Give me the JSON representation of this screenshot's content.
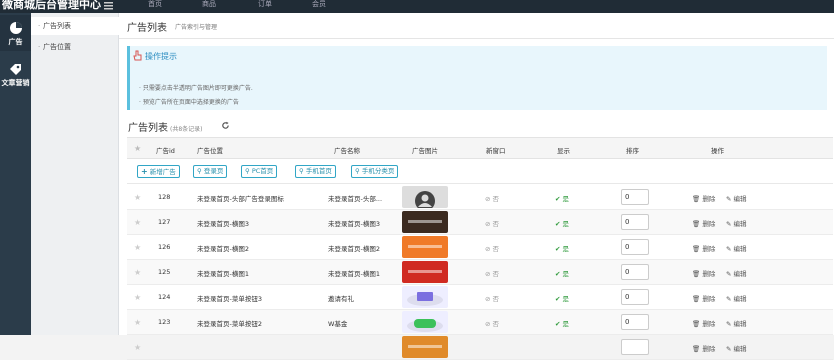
{
  "app": {
    "brand": "微商城后台管理中心",
    "top_items": [
      "首页",
      "商品",
      "订单",
      "会员"
    ]
  },
  "leftbar": [
    {
      "label": "广告",
      "icon": "pie-chart-icon",
      "active": true
    },
    {
      "label": "文章营销",
      "icon": "tag-icon",
      "active": false
    }
  ],
  "subnav": [
    {
      "label": "广告列表",
      "active": true
    },
    {
      "label": "广告位置",
      "active": false
    }
  ],
  "header": {
    "title": "广告列表",
    "subtitle": "广告索引与管理"
  },
  "tip": {
    "title": "操作提示",
    "lines": [
      "只需要点击半透明广告图片即可更换广告.",
      "预览广告所在页面中选择更换的广告"
    ]
  },
  "section": {
    "title": "广告列表",
    "count": "(共8条记录)"
  },
  "columns": [
    "广告id",
    "广告位置",
    "广告名称",
    "广告图片",
    "新窗口",
    "显示",
    "排序",
    "操作"
  ],
  "toolbar": [
    "新增广告",
    "登录页",
    "PC首页",
    "手机首页",
    "手机分类页"
  ],
  "rows": [
    {
      "id": "128",
      "position": "未登录首页-头部广告登录图标",
      "name": "未登录首页-头部...",
      "image_color": "#d6d6d6",
      "image_kind": "avatar",
      "new_window": "否",
      "show": "是",
      "sort": "0"
    },
    {
      "id": "127",
      "position": "未登录首页-横图3",
      "name": "未登录首页-横图3",
      "image_color": "#3b2a20",
      "image_kind": "banner",
      "new_window": "否",
      "show": "是",
      "sort": "0"
    },
    {
      "id": "126",
      "position": "未登录首页-横图2",
      "name": "未登录首页-横图2",
      "image_color": "#f07a28",
      "image_kind": "banner",
      "new_window": "否",
      "show": "是",
      "sort": "0"
    },
    {
      "id": "125",
      "position": "未登录首页-横图1",
      "name": "未登录首页-横图1",
      "image_color": "#d02a22",
      "image_kind": "banner",
      "new_window": "否",
      "show": "是",
      "sort": "0"
    },
    {
      "id": "124",
      "position": "未登录首页-菜单按钮3",
      "name": "邀请有礼",
      "image_color": "#7b6fe0",
      "image_kind": "gift",
      "new_window": "否",
      "show": "是",
      "sort": "0"
    },
    {
      "id": "123",
      "position": "未登录首页-菜单按钮2",
      "name": "W基金",
      "image_color": "#3bc15a",
      "image_kind": "coin",
      "new_window": "否",
      "show": "是",
      "sort": "0"
    },
    {
      "id": "",
      "position": "",
      "name": "",
      "image_color": "#e08a2a",
      "image_kind": "banner",
      "new_window": "",
      "show": "",
      "sort": ""
    }
  ],
  "actions": {
    "delete": "删除",
    "edit": "编辑"
  }
}
